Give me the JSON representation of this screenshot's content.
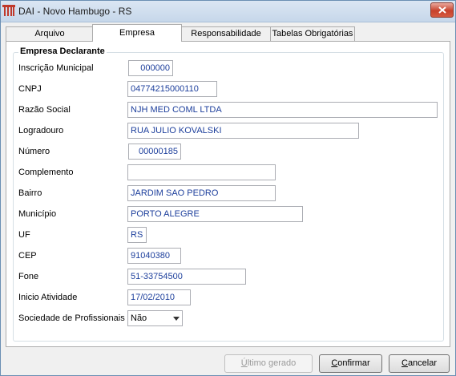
{
  "window": {
    "title": "DAI - Novo Hambugo - RS"
  },
  "tabs": [
    {
      "label": "Arquivo"
    },
    {
      "label": "Empresa"
    },
    {
      "label": "Responsabilidade"
    },
    {
      "label": "Tabelas Obrigatórias"
    }
  ],
  "active_tab": "Empresa",
  "group": {
    "title": "Empresa Declarante"
  },
  "fields": {
    "inscricao_municipal": {
      "label": "Inscrição Municipal",
      "value": "000000"
    },
    "cnpj": {
      "label": "CNPJ",
      "value": "04774215000110"
    },
    "razao_social": {
      "label": "Razão Social",
      "value": "NJH MED COML LTDA"
    },
    "logradouro": {
      "label": "Logradouro",
      "value": "RUA JULIO KOVALSKI"
    },
    "numero": {
      "label": "Número",
      "value": "00000185"
    },
    "complemento": {
      "label": "Complemento",
      "value": ""
    },
    "bairro": {
      "label": "Bairro",
      "value": "JARDIM SAO PEDRO"
    },
    "municipio": {
      "label": "Município",
      "value": "PORTO ALEGRE"
    },
    "uf": {
      "label": "UF",
      "value": "RS"
    },
    "cep": {
      "label": "CEP",
      "value": "91040380"
    },
    "fone": {
      "label": "Fone",
      "value": "51-33754500"
    },
    "inicio_atividade": {
      "label": "Inicio Atividade",
      "value": "17/02/2010"
    },
    "sociedade_profissionais": {
      "label": "Sociedade de Profissionais",
      "value": "Não"
    }
  },
  "buttons": {
    "ultimo_gerado": {
      "prefix": "Ú",
      "rest": "ltimo gerado",
      "enabled": false
    },
    "confirmar": {
      "prefix": "C",
      "rest": "onfirmar"
    },
    "cancelar": {
      "prefix": "C",
      "rest": "ancelar"
    }
  },
  "colors": {
    "field_text": "#1d3f9c",
    "close_button": "#c7412b"
  }
}
